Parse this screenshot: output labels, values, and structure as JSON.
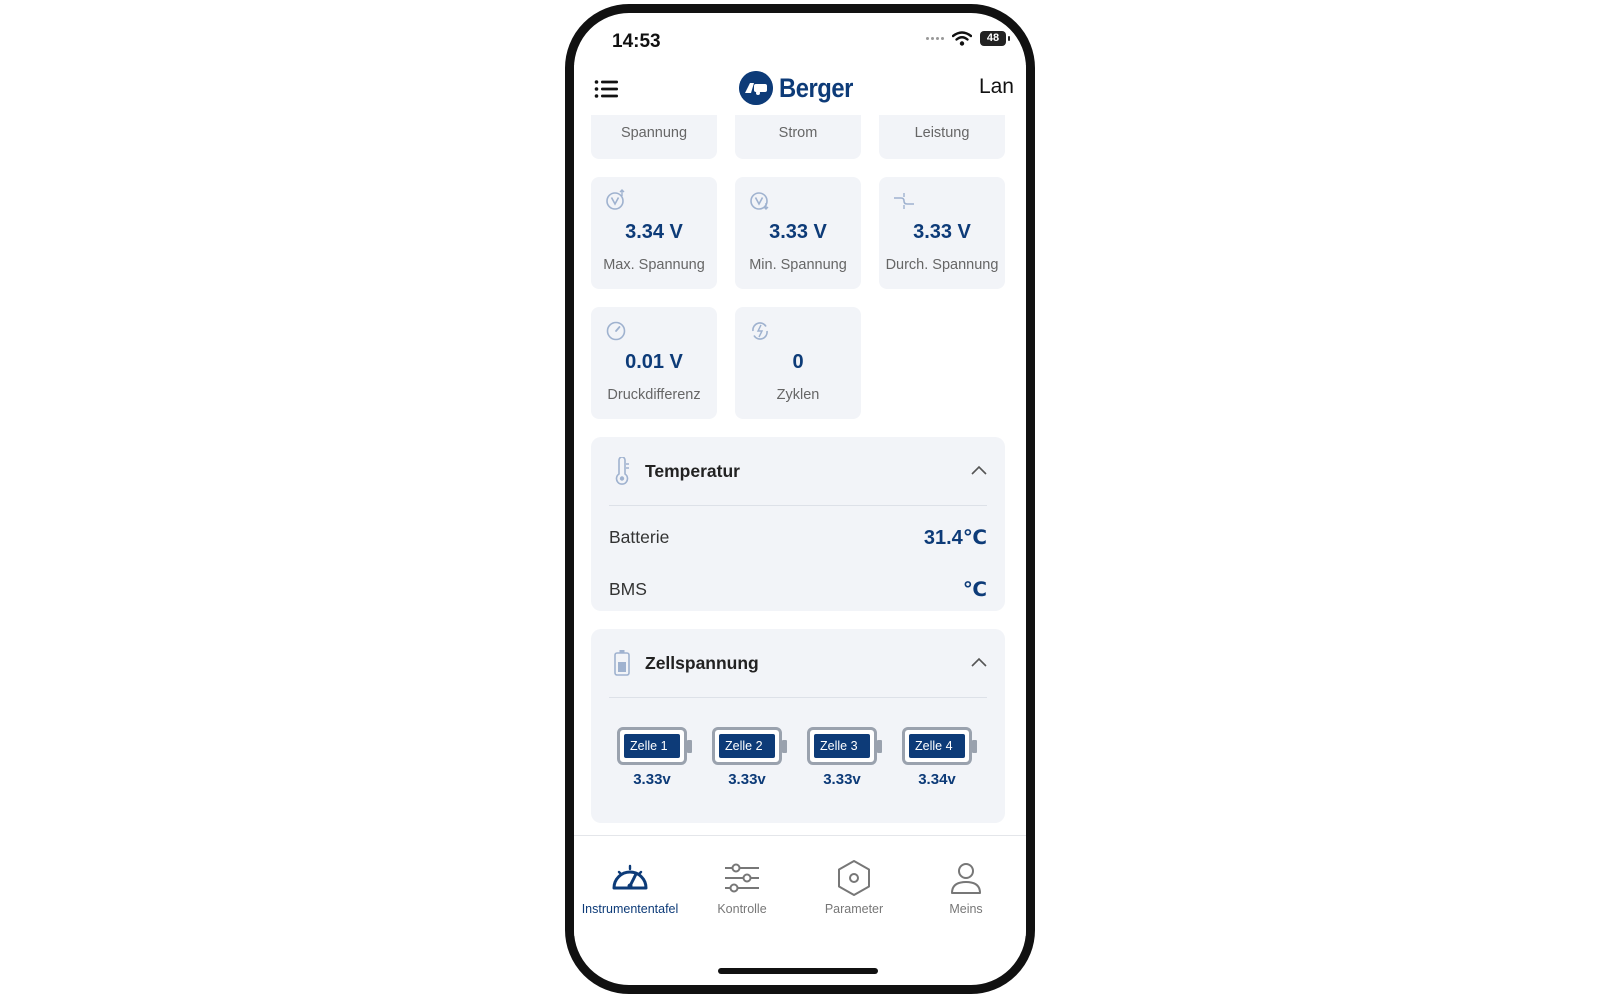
{
  "status_bar": {
    "time": "14:53",
    "battery": "48"
  },
  "header": {
    "brand": "Berger",
    "language": "Lan"
  },
  "summary_tiles": [
    {
      "label": "Spannung"
    },
    {
      "label": "Strom"
    },
    {
      "label": "Leistung"
    }
  ],
  "metrics": [
    {
      "icon": "voltage-up-icon",
      "value": "3.34 V",
      "label": "Max. Spannung"
    },
    {
      "icon": "voltage-down-icon",
      "value": "3.33 V",
      "label": "Min. Spannung"
    },
    {
      "icon": "wave-icon",
      "value": "3.33 V",
      "label": "Durch. Spannung"
    },
    {
      "icon": "gauge-icon",
      "value": "0.01 V",
      "label": "Druckdifferenz"
    },
    {
      "icon": "cycle-icon",
      "value": "0",
      "label": "Zyklen"
    }
  ],
  "temperature": {
    "title": "Temperatur",
    "rows": [
      {
        "name": "Batterie",
        "value": "31.4℃"
      },
      {
        "name": "BMS",
        "value": "℃"
      }
    ]
  },
  "cell_voltage": {
    "title": "Zellspannung",
    "cells": [
      {
        "name": "Zelle 1",
        "value": "3.33v"
      },
      {
        "name": "Zelle 2",
        "value": "3.33v"
      },
      {
        "name": "Zelle 3",
        "value": "3.33v"
      },
      {
        "name": "Zelle 4",
        "value": "3.34v"
      }
    ]
  },
  "tabs": [
    {
      "label": "Instrumententafel",
      "icon": "dashboard-icon",
      "active": true
    },
    {
      "label": "Kontrolle",
      "icon": "sliders-icon",
      "active": false
    },
    {
      "label": "Parameter",
      "icon": "hexagon-settings-icon",
      "active": false
    },
    {
      "label": "Meins",
      "icon": "user-icon",
      "active": false
    }
  ],
  "colors": {
    "accent": "#0d3b78",
    "tile_bg": "#f2f4f8",
    "icon_muted": "#9fb2cf"
  }
}
